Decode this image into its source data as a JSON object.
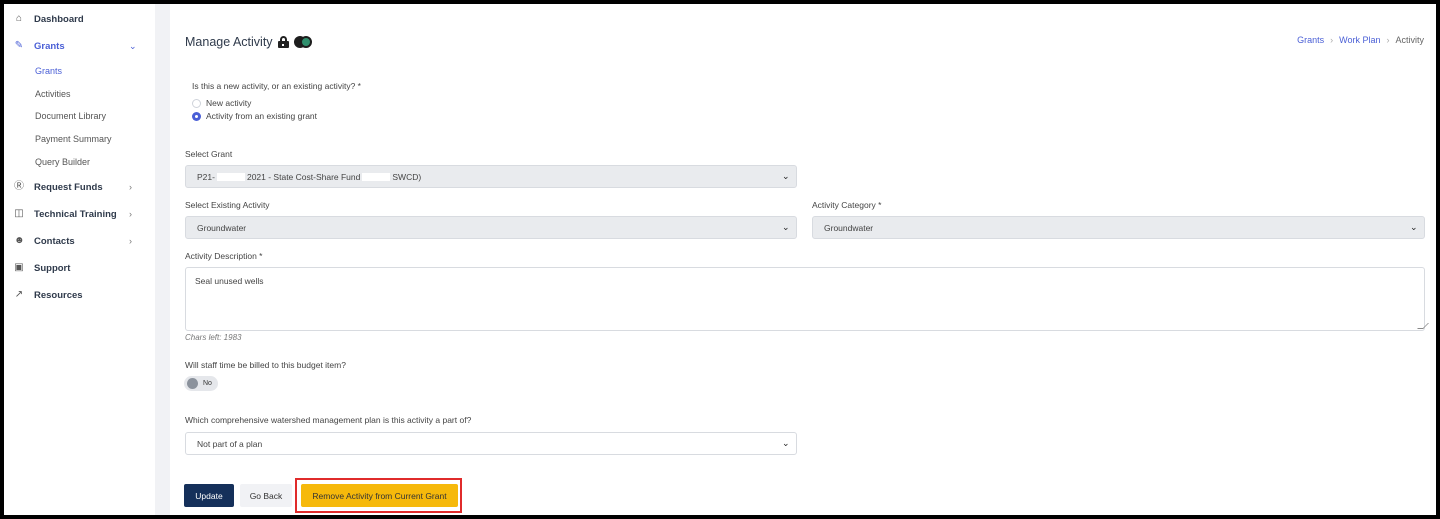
{
  "sidebar": {
    "items": [
      {
        "label": "Dashboard"
      },
      {
        "label": "Grants"
      },
      {
        "label": "Request Funds"
      },
      {
        "label": "Technical Training"
      },
      {
        "label": "Contacts"
      },
      {
        "label": "Support"
      },
      {
        "label": "Resources"
      }
    ],
    "grants_sub": [
      "Grants",
      "Activities",
      "Document Library",
      "Payment Summary",
      "Query Builder"
    ]
  },
  "header": {
    "title": "Manage Activity",
    "breadcrumb": [
      "Grants",
      "Work Plan",
      "Activity"
    ]
  },
  "form": {
    "new_or_existing_label": "Is this a new activity, or an existing activity? *",
    "options": [
      "New activity",
      "Activity from an existing grant"
    ],
    "selected_option": "Activity from an existing grant",
    "select_grant_label": "Select Grant",
    "grant_value_prefix": "P21-",
    "grant_value_mid": "2021 - State Cost-Share Fund",
    "grant_value_suffix": "SWCD)",
    "existing_activity_label": "Select Existing Activity",
    "existing_activity_value": "Groundwater",
    "category_label": "Activity Category *",
    "category_value": "Groundwater",
    "description_label": "Activity Description *",
    "description_value": "Seal unused wells",
    "chars_left": "Chars left: 1983",
    "staff_time_label": "Will staff time be billed to this budget item?",
    "staff_time_value": "No",
    "plan_label": "Which comprehensive watershed management plan is this activity a part of?",
    "plan_value": "Not part of a plan"
  },
  "actions": {
    "update": "Update",
    "go_back": "Go Back",
    "remove": "Remove Activity from Current Grant"
  },
  "colors": {
    "accent": "#4a5fd6",
    "primary_button": "#15305a",
    "warning_button": "#f6b90b",
    "highlight_border": "#e02b2b"
  }
}
